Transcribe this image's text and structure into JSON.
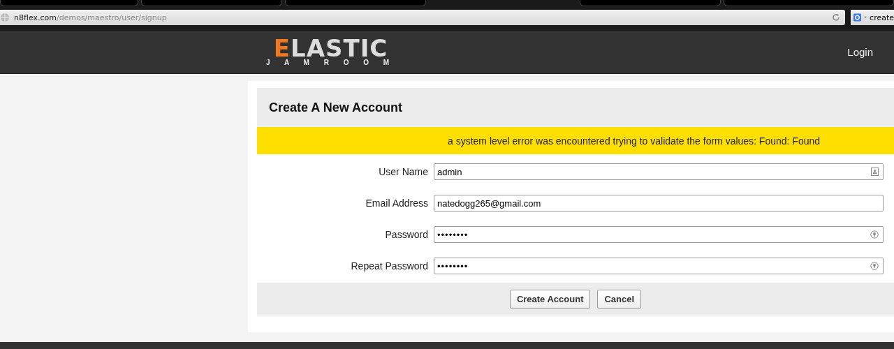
{
  "browser": {
    "address": {
      "domain": "n8flex.com",
      "path": "/demos/maestro/user/signup"
    },
    "search_field": {
      "value": "create"
    }
  },
  "header": {
    "logo": {
      "initial": "E",
      "rest": "LASTIC",
      "tagline": "J A M R O O M"
    },
    "nav": [
      "Login"
    ]
  },
  "form": {
    "title": "Create A New Account",
    "error": "a system level error was encountered trying to validate the form values: Found: Found",
    "fields": [
      {
        "label": "User Name",
        "value": "admin",
        "kind": "text"
      },
      {
        "label": "Email Address",
        "value": "natedogg265@gmail.com",
        "kind": "email"
      },
      {
        "label": "Password",
        "value": "••••••••",
        "kind": "password"
      },
      {
        "label": "Repeat Password",
        "value": "••••••••",
        "kind": "password"
      }
    ],
    "buttons": [
      "Create Account",
      "Cancel"
    ]
  }
}
